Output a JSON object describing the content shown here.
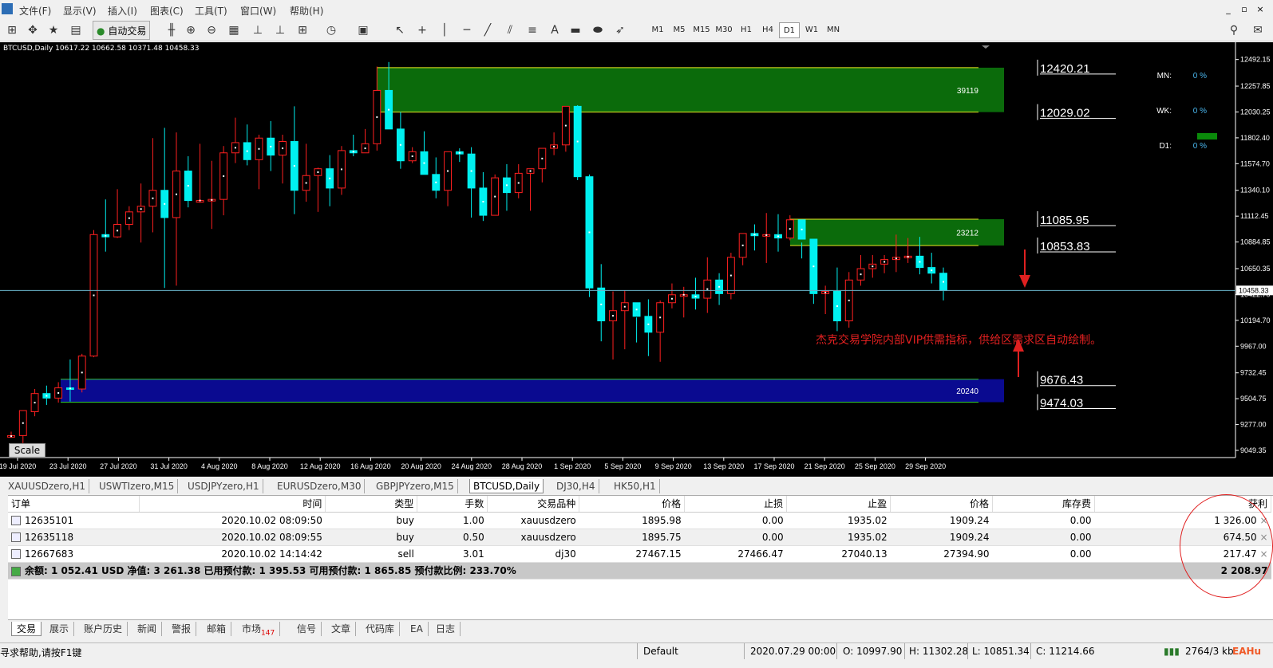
{
  "menu": [
    "文件(F)",
    "显示(V)",
    "插入(I)",
    "图表(C)",
    "工具(T)",
    "窗口(W)",
    "帮助(H)"
  ],
  "window_buttons": [
    "_",
    "▫",
    "×"
  ],
  "toolbar": {
    "auto_trade": "自动交易",
    "text_tool": "A",
    "timeframes": [
      "M1",
      "M5",
      "M15",
      "M30",
      "H1",
      "H4",
      "D1",
      "W1",
      "MN"
    ],
    "active_tf": "D1"
  },
  "chart": {
    "header": "BTCUSD,Daily 10617.22 10662.58 10371.48 10458.33",
    "symbol": "BTCUSD",
    "timeframe": "Daily",
    "current_price": "10458.33",
    "scale_button": "Scale",
    "annotation": "杰克交易学院内部VIP供需指标，供给区需求区自动绘制。",
    "levels": [
      "12420.21",
      "12029.02",
      "11085.95",
      "10853.83",
      "9676.43",
      "9474.03"
    ],
    "zone_labels": [
      "39119",
      "23212",
      "20240"
    ],
    "mode_rows": [
      {
        "label": "MN:",
        "value": "0 %"
      },
      {
        "label": "WK:",
        "value": "0 %"
      },
      {
        "label": "D1:",
        "value": "0 %"
      }
    ]
  },
  "chart_data": {
    "type": "candlestick",
    "price_ticks": [
      "12492.15",
      "12257.85",
      "12030.25",
      "11802.40",
      "11574.70",
      "11340.10",
      "11112.45",
      "10884.85",
      "10650.35",
      "10422.70",
      "10194.70",
      "9967.00",
      "9732.45",
      "9504.75",
      "9277.00",
      "9049.35"
    ],
    "date_labels": [
      "19 Jul 2020",
      "23 Jul 2020",
      "27 Jul 2020",
      "31 Jul 2020",
      "4 Aug 2020",
      "8 Aug 2020",
      "12 Aug 2020",
      "16 Aug 2020",
      "20 Aug 2020",
      "24 Aug 2020",
      "28 Aug 2020",
      "1 Sep 2020",
      "5 Sep 2020",
      "9 Sep 2020",
      "13 Sep 2020",
      "17 Sep 2020",
      "21 Sep 2020",
      "25 Sep 2020",
      "29 Sep 2020"
    ],
    "ohlc": [
      [
        9169,
        9214,
        9160,
        9180
      ],
      [
        9180,
        9380,
        9050,
        9400
      ],
      [
        9390,
        9590,
        9350,
        9550
      ],
      [
        9550,
        9620,
        9450,
        9510
      ],
      [
        9510,
        9650,
        9470,
        9600
      ],
      [
        9600,
        9850,
        9480,
        9590
      ],
      [
        9590,
        9900,
        9560,
        9880
      ],
      [
        9880,
        10990,
        9870,
        10950
      ],
      [
        10950,
        11260,
        10800,
        10930
      ],
      [
        10930,
        11350,
        10920,
        11040
      ],
      [
        11040,
        11200,
        10990,
        11150
      ],
      [
        11150,
        11400,
        10880,
        11200
      ],
      [
        11200,
        11800,
        10970,
        11340
      ],
      [
        11340,
        11890,
        10480,
        11100
      ],
      [
        11100,
        11850,
        10500,
        11510
      ],
      [
        11510,
        11640,
        11190,
        11250
      ],
      [
        11250,
        11750,
        11230,
        11250
      ],
      [
        11250,
        11600,
        11000,
        11260
      ],
      [
        11260,
        11730,
        11120,
        11670
      ],
      [
        11670,
        11980,
        11580,
        11760
      ],
      [
        11760,
        11920,
        11560,
        11610
      ],
      [
        11610,
        11830,
        11350,
        11800
      ],
      [
        11800,
        11950,
        11510,
        11650
      ],
      [
        11650,
        11830,
        11400,
        11770
      ],
      [
        11770,
        12080,
        11130,
        11340
      ],
      [
        11340,
        11750,
        11240,
        11470
      ],
      [
        11470,
        11540,
        11150,
        11530
      ],
      [
        11530,
        11650,
        11200,
        11360
      ],
      [
        11360,
        11730,
        11300,
        11690
      ],
      [
        11690,
        11830,
        11640,
        11670
      ],
      [
        11670,
        11880,
        11690,
        11750
      ],
      [
        11750,
        12430,
        11690,
        12220
      ],
      [
        12220,
        12470,
        11950,
        11880
      ],
      [
        11880,
        12030,
        11530,
        11600
      ],
      [
        11600,
        11720,
        11580,
        11680
      ],
      [
        11680,
        11860,
        11490,
        11480
      ],
      [
        11480,
        11630,
        11270,
        11340
      ],
      [
        11340,
        11590,
        11200,
        11680
      ],
      [
        11680,
        11710,
        11590,
        11660
      ],
      [
        11660,
        11720,
        11100,
        11360
      ],
      [
        11360,
        11500,
        11070,
        11120
      ],
      [
        11120,
        11480,
        11200,
        11450
      ],
      [
        11450,
        11570,
        11160,
        11320
      ],
      [
        11320,
        11570,
        11270,
        11490
      ],
      [
        11490,
        11530,
        11160,
        11530
      ],
      [
        11530,
        11640,
        11410,
        11710
      ],
      [
        11710,
        11850,
        11650,
        11740
      ],
      [
        11740,
        12080,
        11680,
        12080
      ],
      [
        12080,
        12090,
        11430,
        11460
      ],
      [
        11460,
        11480,
        10400,
        10480
      ],
      [
        10480,
        10690,
        10010,
        10190
      ],
      [
        10190,
        10450,
        9850,
        10280
      ],
      [
        10280,
        10460,
        9940,
        10350
      ],
      [
        10350,
        10220,
        10000,
        10230
      ],
      [
        10230,
        10380,
        9880,
        10090
      ],
      [
        10090,
        10370,
        9830,
        10350
      ],
      [
        10350,
        10520,
        10300,
        10420
      ],
      [
        10420,
        10490,
        10220,
        10420
      ],
      [
        10420,
        10570,
        10290,
        10390
      ],
      [
        10390,
        10750,
        10260,
        10550
      ],
      [
        10550,
        10610,
        10330,
        10430
      ],
      [
        10430,
        10790,
        10380,
        10750
      ],
      [
        10750,
        10940,
        10680,
        10960
      ],
      [
        10960,
        11040,
        10810,
        10940
      ],
      [
        10940,
        11140,
        10700,
        10950
      ],
      [
        10950,
        11130,
        10800,
        10920
      ],
      [
        10920,
        11120,
        10900,
        11080
      ],
      [
        11080,
        10880,
        10740,
        10910
      ],
      [
        10910,
        10780,
        10340,
        10430
      ],
      [
        10430,
        10500,
        10250,
        10450
      ],
      [
        10450,
        10660,
        10100,
        10190
      ],
      [
        10190,
        10620,
        10130,
        10550
      ],
      [
        10550,
        10770,
        10500,
        10650
      ],
      [
        10650,
        10770,
        10570,
        10690
      ],
      [
        10690,
        10770,
        10610,
        10730
      ],
      [
        10730,
        10950,
        10620,
        10750
      ],
      [
        10750,
        10920,
        10700,
        10760
      ],
      [
        10760,
        10930,
        10600,
        10660
      ],
      [
        10660,
        10790,
        10520,
        10610
      ],
      [
        10610,
        10660,
        10370,
        10458
      ]
    ],
    "zones": [
      {
        "type": "supply",
        "high": 12420.21,
        "low": 12029.02,
        "label": "39119"
      },
      {
        "type": "supply",
        "high": 11085.95,
        "low": 10853.83,
        "label": "23212"
      },
      {
        "type": "demand",
        "high": 9676.43,
        "low": 9474.03,
        "label": "20240"
      }
    ],
    "ylim": [
      9049.35,
      12560
    ]
  },
  "chart_tabs": [
    "XAUUSDzero,H1",
    "USWTIzero,M15",
    "USDJPYzero,H1",
    "EURUSDzero,M30",
    "GBPJPYzero,M15",
    "BTCUSD,Daily",
    "DJ30,H4",
    "HK50,H1"
  ],
  "active_chart_tab": "BTCUSD,Daily",
  "orders": {
    "headers": [
      "订单",
      "时间",
      "类型",
      "手数",
      "交易品种",
      "价格",
      "止损",
      "止盈",
      "价格",
      "库存费",
      "获利"
    ],
    "rows": [
      {
        "ticket": "12635101",
        "time": "2020.10.02 08:09:50",
        "type": "buy",
        "volume": "1.00",
        "symbol": "xauusdzero",
        "price": "1895.98",
        "sl": "0.00",
        "tp": "1935.02",
        "cur": "1909.24",
        "swap": "0.00",
        "profit": "1 326.00"
      },
      {
        "ticket": "12635118",
        "time": "2020.10.02 08:09:55",
        "type": "buy",
        "volume": "0.50",
        "symbol": "xauusdzero",
        "price": "1895.75",
        "sl": "0.00",
        "tp": "1935.02",
        "cur": "1909.24",
        "swap": "0.00",
        "profit": "674.50"
      },
      {
        "ticket": "12667683",
        "time": "2020.10.02 14:14:42",
        "type": "sell",
        "volume": "3.01",
        "symbol": "dj30",
        "price": "27467.15",
        "sl": "27466.47",
        "tp": "27040.13",
        "cur": "27394.90",
        "swap": "0.00",
        "profit": "217.47"
      }
    ],
    "summary": "余额: 1 052.41 USD  净值: 3 261.38  已用预付款: 1 395.53  可用预付款: 1 865.85  预付款比例: 233.70%",
    "total_profit": "2 208.97"
  },
  "bottom_tabs": [
    "交易",
    "展示",
    "账户历史",
    "新闻",
    "警报",
    "邮箱",
    "市场",
    "信号",
    "文章",
    "代码库",
    "EA",
    "日志"
  ],
  "market_badge": "147",
  "status": {
    "help": "寻求帮助,请按F1键",
    "profile": "Default",
    "datetime": "2020.07.29 00:00",
    "open": "O: 10997.90",
    "high": "H: 11302.28",
    "low": "L: 10851.34",
    "close": "C: 11214.66",
    "traffic": "2764/3 kb"
  },
  "watermark": "EAHu"
}
